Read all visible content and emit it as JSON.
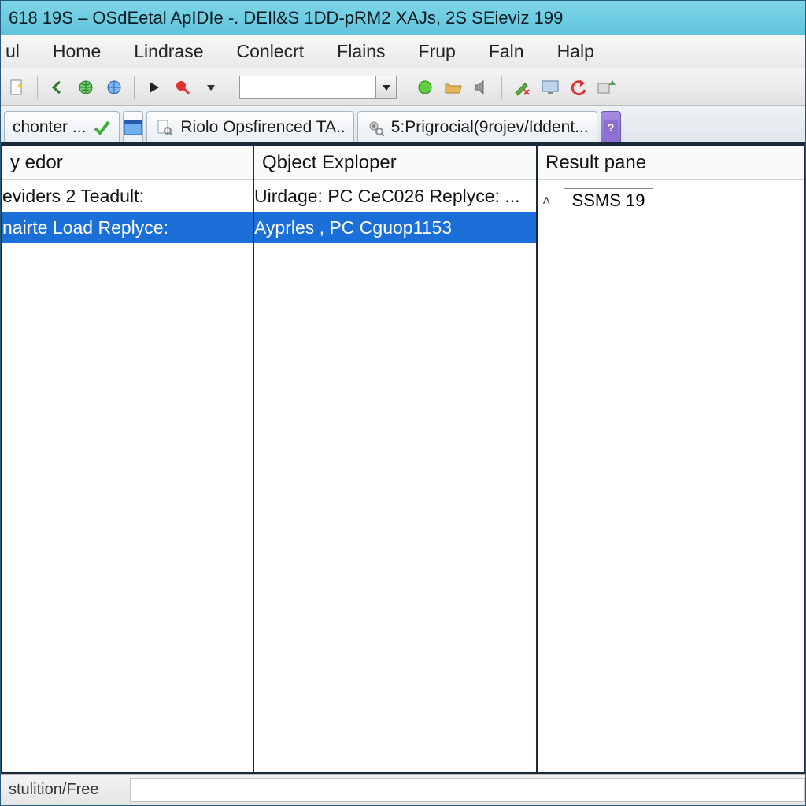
{
  "title": "618 19S – OSdEetal ApIDIe -. DEIl&S 1DD-pRM2 XAJs, 2S SEieviz 199",
  "menu": [
    "ul",
    "Home",
    "Lindrase",
    "Conlecrt",
    "Flains",
    "Frup",
    "Faln",
    "Halp"
  ],
  "toolbar_icons": [
    "doc-star-icon",
    "sep",
    "back-arrow-icon",
    "globe-green-icon",
    "globe-blue-icon",
    "sep",
    "play-icon",
    "stop-red-icon",
    "dropdown-icon",
    "sep",
    "input",
    "sep",
    "circle-green-icon",
    "folder-open-icon",
    "speaker-icon",
    "sep",
    "pencil-x-icon",
    "monitor-icon",
    "undo-red-icon",
    "redo-tool-icon"
  ],
  "tabs": [
    {
      "label": "chonter ...",
      "icon": "check-green-icon"
    },
    {
      "label": "",
      "icon": "window-blue-icon",
      "narrow": true
    },
    {
      "label": "Riolo Opsfirenced TA..",
      "icon": "doc-search-icon"
    },
    {
      "label": "5:Prigrocial(9rojev/Iddent...",
      "icon": "gear-search-icon"
    },
    {
      "label": "",
      "icon": "question-icon",
      "purple": true
    }
  ],
  "panes": {
    "p1": {
      "header": "y edor",
      "rows": [
        {
          "text": "eviders 2 Teadult:",
          "sel": false
        },
        {
          "text": "nairte Load Replyce:",
          "sel": true
        }
      ]
    },
    "p2": {
      "header": "Qbject Exploper",
      "rows": [
        {
          "text": "Uirdage: PC CeC026 Replyce: ...",
          "sel": false
        },
        {
          "text": "Ayprles , PC Cguop1153",
          "sel": true
        }
      ]
    },
    "p3": {
      "header": "Result pane",
      "value": "SSMS 19"
    }
  },
  "status": {
    "left": "stulition/Free"
  }
}
